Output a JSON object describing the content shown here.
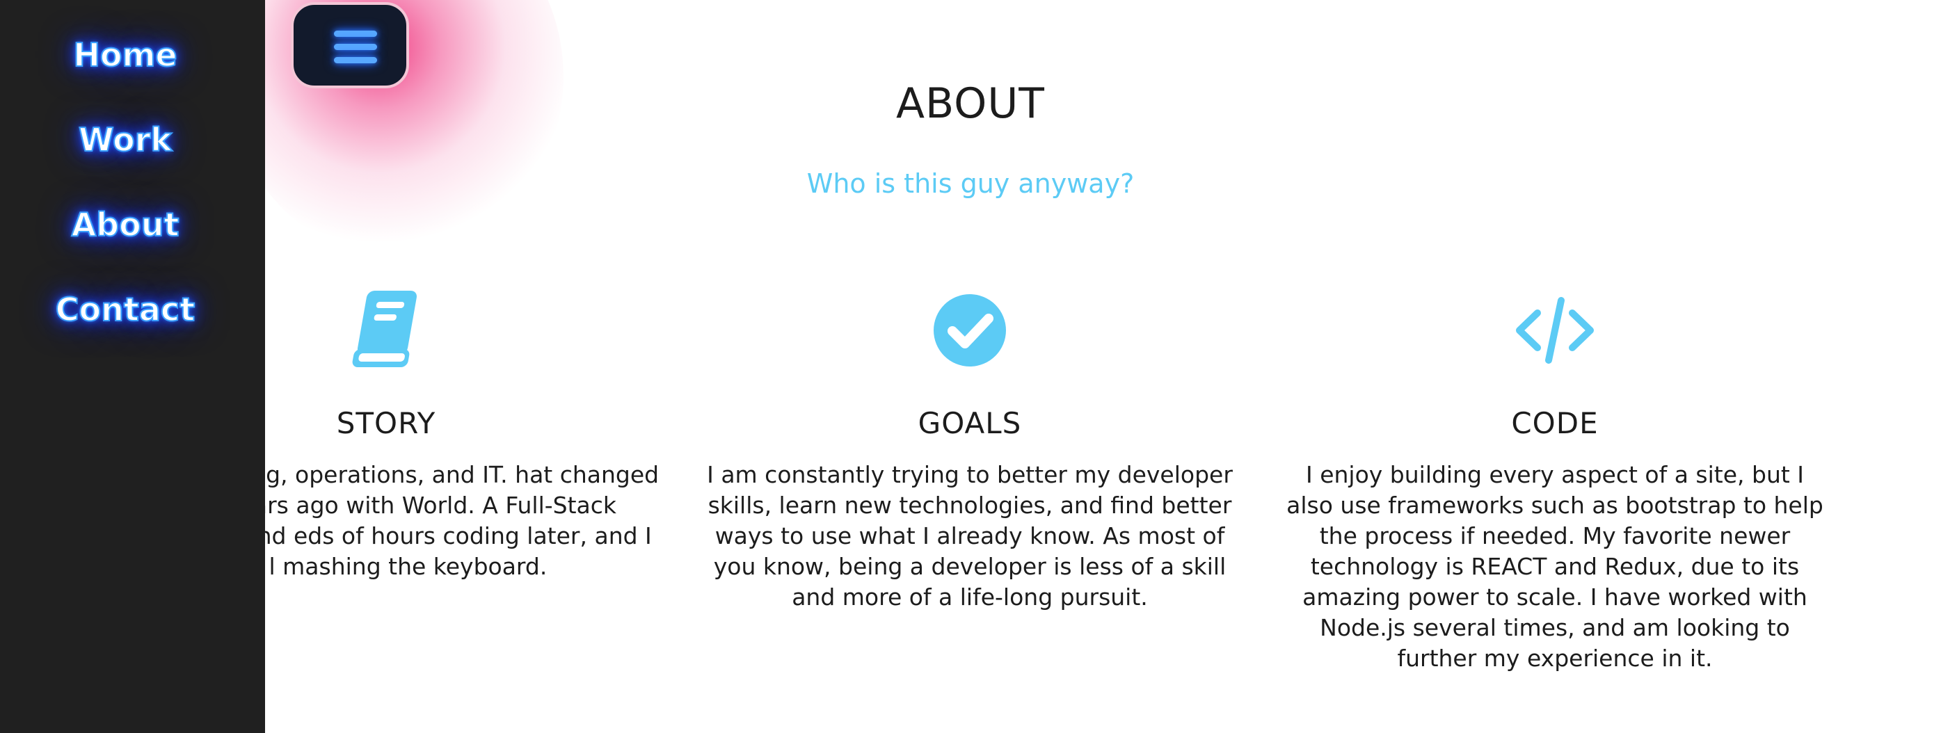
{
  "nav": {
    "items": [
      {
        "label": "Home"
      },
      {
        "label": "Work"
      },
      {
        "label": "About"
      },
      {
        "label": "Contact"
      }
    ]
  },
  "menu_button": {
    "icon": "hamburger-icon"
  },
  "about": {
    "title": "ABOUT",
    "subtitle": "Who is this guy anyway?",
    "columns": [
      {
        "icon": "book-icon",
        "heading": "STORY",
        "text": "d in marketing, operations, and IT. hat changed a few years ago with World. A Full-Stack bootcamp and eds of hours coding later, and I am l mashing the keyboard."
      },
      {
        "icon": "check-circle-icon",
        "heading": "GOALS",
        "text": "I am constantly trying to better my developer skills, learn new technologies, and find better ways to use what I already know. As most of you know, being a developer is less of a skill and more of a life-long pursuit."
      },
      {
        "icon": "code-icon",
        "heading": "CODE",
        "text": "I enjoy building every aspect of a site, but I also use frameworks such as bootstrap to help the process if needed. My favorite newer technology is REACT and Redux, due to its amazing power to scale. I have worked with Node.js several times, and am looking to further my experience in it."
      }
    ]
  },
  "colors": {
    "accent": "#5ccbf5",
    "sidebar_bg": "#202020",
    "neon_blue": "#3aa0ff",
    "glow_pink": "#ee1e6e",
    "menu_button_bg": "#121a2c"
  }
}
